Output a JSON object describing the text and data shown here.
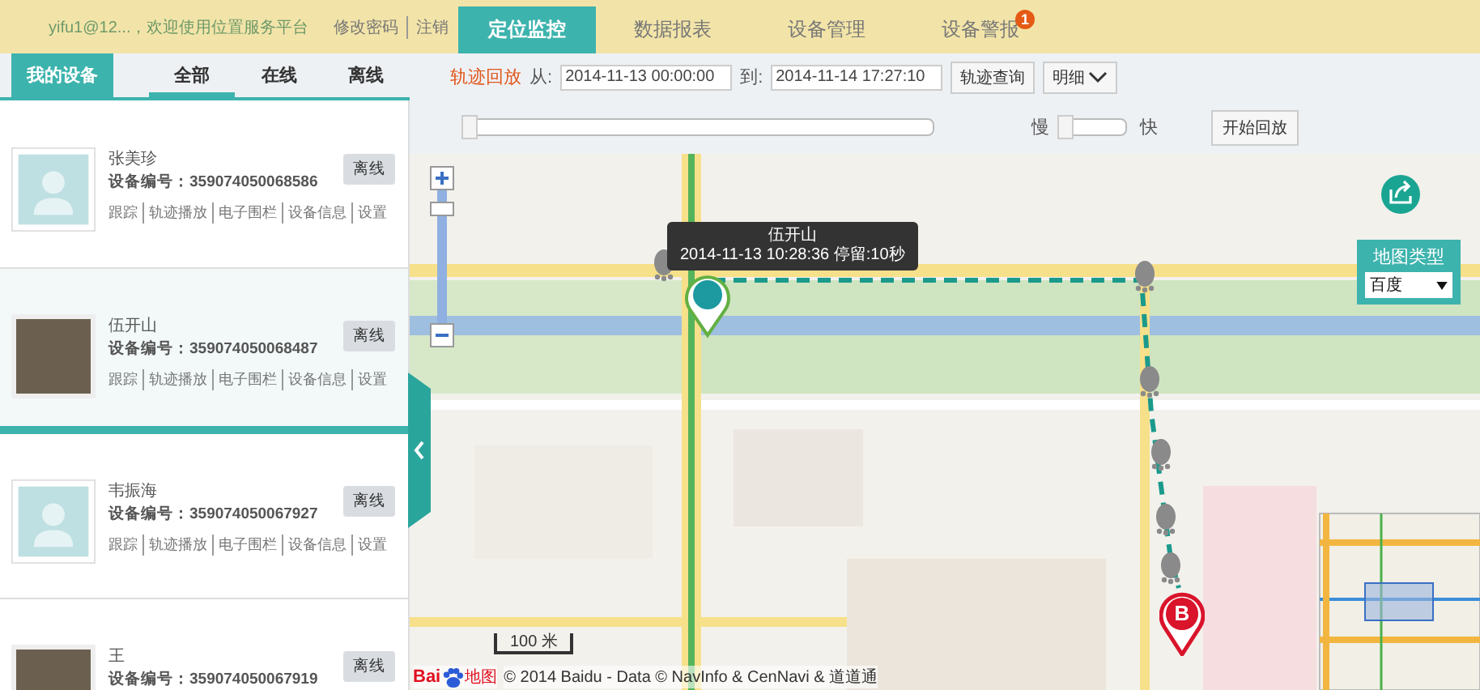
{
  "header": {
    "welcome": "yifu1@12...，欢迎使用位置服务平台",
    "links": [
      "修改密码",
      "注销"
    ],
    "nav": [
      {
        "label": "定位监控",
        "selected": true
      },
      {
        "label": "数据报表",
        "selected": false
      },
      {
        "label": "设备管理",
        "selected": false
      },
      {
        "label": "设备警报",
        "selected": false,
        "badge": "1"
      }
    ]
  },
  "sidebar": {
    "title": "我的设备",
    "filters": [
      {
        "label": "全部",
        "selected": true
      },
      {
        "label": "在线",
        "selected": false
      },
      {
        "label": "离线",
        "selected": false
      }
    ],
    "devices": [
      {
        "name": "张美珍",
        "device_no": "设备编号：359074050068586",
        "photo": false,
        "selected": false,
        "status": "离线",
        "links": [
          "跟踪",
          "轨迹播放",
          "电子围栏",
          "设备信息",
          "设置"
        ]
      },
      {
        "name": "伍开山",
        "device_no": "设备编号：359074050068487",
        "photo": true,
        "selected": true,
        "status": "离线",
        "links": [
          "跟踪",
          "轨迹播放",
          "电子围栏",
          "设备信息",
          "设置"
        ]
      },
      {
        "name": "韦振海",
        "device_no": "设备编号：359074050067927",
        "photo": false,
        "selected": false,
        "status": "离线",
        "links": [
          "跟踪",
          "轨迹播放",
          "电子围栏",
          "设备信息",
          "设置"
        ]
      },
      {
        "name": "王",
        "device_no": "设备编号：359074050067919",
        "photo": true,
        "selected": false,
        "status": "离线"
      }
    ]
  },
  "playback": {
    "title": "轨迹回放",
    "from_label": "从:",
    "from": "2014-11-13 00:00:00",
    "to_label": "到:",
    "to": "2014-11-14 17:27:10",
    "query_button": "轨迹查询",
    "detail_button": "明细",
    "progress": {
      "level": 0
    },
    "slow": "慢",
    "speed": {
      "level": 0
    },
    "fast": "快",
    "start_button": "开始回放"
  },
  "map": {
    "tooltip": {
      "name": "伍开山",
      "info": "2014-11-13 10:28:36 停留:10秒"
    },
    "map_type": {
      "label": "地图类型",
      "value": "百度"
    },
    "end_marker": "B",
    "scale": "100 米",
    "logo": [
      "Bai",
      "地图"
    ],
    "attribution": "© 2014 Baidu - Data © NavInfo & CenNavi & 道道通"
  }
}
